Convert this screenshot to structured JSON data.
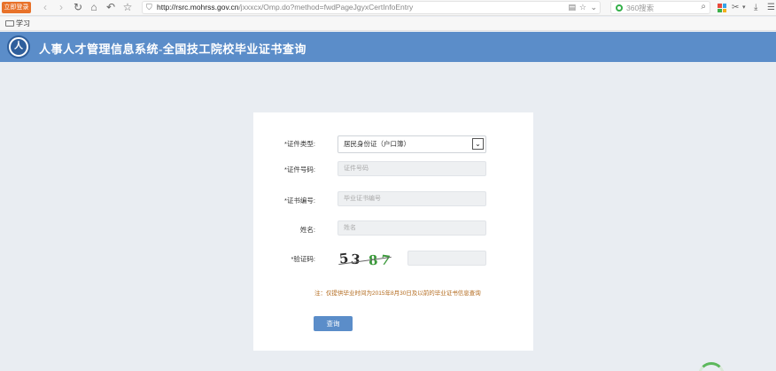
{
  "browser": {
    "login_badge": "立即登录",
    "url_domain": "http://rsrc.mohrss.gov.cn",
    "url_path": "/jxxxcx/Omp.do?method=fwdPageJgyxCertInfoEntry",
    "search_placeholder": "360搜索",
    "bookmark_label": "学习"
  },
  "header": {
    "emblem_text": "人",
    "title": "人事人才管理信息系统-全国技工院校毕业证书查询"
  },
  "form": {
    "cert_type_label": "*证件类型:",
    "cert_type_value": "居民身份证（户口簿）",
    "id_number_label": "*证件号码:",
    "id_number_placeholder": "证件号码",
    "cert_number_label": "*证书编号:",
    "cert_number_placeholder": "毕业证书编号",
    "name_label": "姓名:",
    "name_placeholder": "姓名",
    "captcha_label": "*验证码:",
    "captcha_chars": [
      "5",
      "3",
      "8",
      "7"
    ],
    "captcha_colors": [
      "#2a2a2a",
      "#2a2a2a",
      "#3c9a3c",
      "#3c9a3c"
    ],
    "note": "注：仅提供毕业时间为2015年8月30日及以前的毕业证书信息查询",
    "submit_label": "查询"
  },
  "colors": {
    "banner": "#5b8dc9",
    "button": "#5b8dc9",
    "note": "#b36b1f",
    "page_bg": "#e9edf2"
  }
}
